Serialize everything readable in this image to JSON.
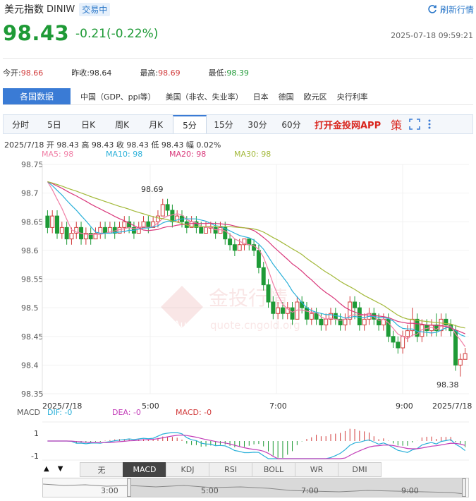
{
  "header": {
    "name": "美元指数",
    "code": "DINIW",
    "status": "交易中",
    "refresh_label": "刷新行情"
  },
  "quote": {
    "price": "98.43",
    "change": "-0.21(-0.22%)",
    "timestamp": "2025-07-18 09:59:21"
  },
  "stats": [
    {
      "label": "今开:",
      "value": "98.66",
      "color": "red"
    },
    {
      "label": "昨收:",
      "value": "98.64",
      "color": "none"
    },
    {
      "label": "最高:",
      "value": "98.69",
      "color": "red"
    },
    {
      "label": "最低:",
      "value": "98.39",
      "color": "grn"
    }
  ],
  "data_tabs": {
    "main": "各国数据",
    "items": [
      "中国（GDP、ppi等）",
      "美国（非农、失业率）",
      "日本",
      "德国",
      "欧元区",
      "央行利率"
    ]
  },
  "period_tabs": {
    "items": [
      "分时",
      "5日",
      "日K",
      "周K",
      "月K",
      "5分",
      "15分",
      "30分",
      "60分"
    ],
    "active": "5分",
    "app_link": "打开金投网APP",
    "strategy_icon": "策",
    "icons": [
      "fullscreen-icon",
      "more-icon"
    ]
  },
  "ohlc_line": "2025/7/18  开 98.43  高 98.43  收 98.43  低 98.43  幅 0.02%",
  "ma_legend": [
    {
      "label": "MA5: 98",
      "color": "#f07fa6"
    },
    {
      "label": "MA10: 98",
      "color": "#2ab0d9"
    },
    {
      "label": "MA20: 98",
      "color": "#d9377a"
    },
    {
      "label": "MA30: 98",
      "color": "#a3b93a"
    }
  ],
  "macd_legend": [
    {
      "label": "MACD",
      "color": "#555555"
    },
    {
      "label": "DIF: -0",
      "color": "#2ab0d9"
    },
    {
      "label": "DEA: -0",
      "color": "#c23cb8"
    },
    {
      "label": "MACD: -0",
      "color": "#d13b3b"
    }
  ],
  "indicator_tabs": {
    "items": [
      "无",
      "MACD",
      "KDJ",
      "RSI",
      "BOLL",
      "WR",
      "DMI"
    ],
    "active": "MACD"
  },
  "navigator_labels": [
    "3:00",
    "5:00",
    "7:00",
    "9:00"
  ],
  "watermark": {
    "text": "金投行情",
    "sub": "quote.cngold.org",
    "logo": "Au"
  },
  "colors": {
    "up": "#d13b3b",
    "down": "#1e9a36",
    "accent": "#3a7bd5",
    "app": "#d9251d"
  },
  "chart_data": {
    "type": "candlestick",
    "y_ticks": [
      "98.75",
      "98.7",
      "98.65",
      "98.6",
      "98.55",
      "98.5",
      "98.45",
      "98.4",
      "98.35"
    ],
    "ylim": [
      98.35,
      98.75
    ],
    "x_labels": [
      "2025/7/18",
      "5:00",
      "7:00",
      "9:00",
      "2025/7/18"
    ],
    "high_label": "98.69",
    "low_label": "98.38",
    "macd_ticks": [
      "1",
      "-1"
    ],
    "candles": [
      [
        98.66,
        98.64,
        98.67,
        98.63
      ],
      [
        98.64,
        98.66,
        98.67,
        98.63
      ],
      [
        98.66,
        98.63,
        98.67,
        98.62
      ],
      [
        98.63,
        98.64,
        98.65,
        98.62
      ],
      [
        98.64,
        98.62,
        98.65,
        98.61
      ],
      [
        98.62,
        98.63,
        98.64,
        98.61
      ],
      [
        98.63,
        98.64,
        98.65,
        98.62
      ],
      [
        98.64,
        98.62,
        98.65,
        98.61
      ],
      [
        98.62,
        98.63,
        98.64,
        98.61
      ],
      [
        98.63,
        98.62,
        98.64,
        98.61
      ],
      [
        98.62,
        98.63,
        98.64,
        98.62
      ],
      [
        98.63,
        98.64,
        98.65,
        98.62
      ],
      [
        98.64,
        98.63,
        98.65,
        98.62
      ],
      [
        98.63,
        98.64,
        98.65,
        98.63
      ],
      [
        98.64,
        98.63,
        98.65,
        98.62
      ],
      [
        98.63,
        98.64,
        98.65,
        98.63
      ],
      [
        98.64,
        98.65,
        98.66,
        98.63
      ],
      [
        98.65,
        98.64,
        98.66,
        98.63
      ],
      [
        98.64,
        98.63,
        98.65,
        98.62
      ],
      [
        98.63,
        98.64,
        98.65,
        98.63
      ],
      [
        98.64,
        98.65,
        98.66,
        98.64
      ],
      [
        98.65,
        98.64,
        98.66,
        98.63
      ],
      [
        98.64,
        98.65,
        98.66,
        98.64
      ],
      [
        98.65,
        98.66,
        98.67,
        98.64
      ],
      [
        98.66,
        98.68,
        98.69,
        98.66
      ],
      [
        98.68,
        98.67,
        98.69,
        98.66
      ],
      [
        98.67,
        98.65,
        98.68,
        98.64
      ],
      [
        98.65,
        98.66,
        98.67,
        98.65
      ],
      [
        98.66,
        98.65,
        98.67,
        98.64
      ],
      [
        98.65,
        98.64,
        98.66,
        98.63
      ],
      [
        98.64,
        98.65,
        98.66,
        98.64
      ],
      [
        98.65,
        98.64,
        98.66,
        98.63
      ],
      [
        98.64,
        98.63,
        98.65,
        98.63
      ],
      [
        98.63,
        98.64,
        98.65,
        98.63
      ],
      [
        98.64,
        98.64,
        98.65,
        98.63
      ],
      [
        98.64,
        98.63,
        98.65,
        98.62
      ],
      [
        98.63,
        98.64,
        98.65,
        98.63
      ],
      [
        98.64,
        98.62,
        98.65,
        98.61
      ],
      [
        98.62,
        98.61,
        98.63,
        98.6
      ],
      [
        98.61,
        98.6,
        98.62,
        98.59
      ],
      [
        98.6,
        98.61,
        98.62,
        98.6
      ],
      [
        98.61,
        98.62,
        98.62,
        98.6
      ],
      [
        98.62,
        98.61,
        98.62,
        98.6
      ],
      [
        98.61,
        98.6,
        98.62,
        98.59
      ],
      [
        98.6,
        98.57,
        98.61,
        98.56
      ],
      [
        98.57,
        98.54,
        98.58,
        98.53
      ],
      [
        98.54,
        98.51,
        98.55,
        98.5
      ],
      [
        98.51,
        98.49,
        98.52,
        98.48
      ],
      [
        98.49,
        98.5,
        98.51,
        98.48
      ],
      [
        98.5,
        98.49,
        98.51,
        98.48
      ],
      [
        98.49,
        98.5,
        98.51,
        98.48
      ],
      [
        98.5,
        98.48,
        98.51,
        98.47
      ],
      [
        98.48,
        98.51,
        98.52,
        98.48
      ],
      [
        98.51,
        98.5,
        98.52,
        98.49
      ],
      [
        98.5,
        98.48,
        98.51,
        98.47
      ],
      [
        98.48,
        98.49,
        98.5,
        98.47
      ],
      [
        98.49,
        98.48,
        98.5,
        98.47
      ],
      [
        98.48,
        98.47,
        98.49,
        98.46
      ],
      [
        98.47,
        98.48,
        98.49,
        98.46
      ],
      [
        98.48,
        98.49,
        98.5,
        98.47
      ],
      [
        98.49,
        98.48,
        98.5,
        98.47
      ],
      [
        98.48,
        98.47,
        98.49,
        98.46
      ],
      [
        98.47,
        98.48,
        98.49,
        98.46
      ],
      [
        98.48,
        98.51,
        98.52,
        98.47
      ],
      [
        98.51,
        98.5,
        98.52,
        98.48
      ],
      [
        98.5,
        98.47,
        98.51,
        98.46
      ],
      [
        98.47,
        98.48,
        98.49,
        98.46
      ],
      [
        98.48,
        98.49,
        98.5,
        98.47
      ],
      [
        98.49,
        98.48,
        98.5,
        98.47
      ],
      [
        98.48,
        98.47,
        98.49,
        98.46
      ],
      [
        98.47,
        98.48,
        98.49,
        98.46
      ],
      [
        98.48,
        98.45,
        98.49,
        98.44
      ],
      [
        98.45,
        98.44,
        98.46,
        98.43
      ],
      [
        98.44,
        98.43,
        98.45,
        98.42
      ],
      [
        98.43,
        98.45,
        98.46,
        98.42
      ],
      [
        98.45,
        98.46,
        98.47,
        98.44
      ],
      [
        98.46,
        98.48,
        98.5,
        98.45
      ],
      [
        98.48,
        98.45,
        98.49,
        98.44
      ],
      [
        98.45,
        98.47,
        98.48,
        98.44
      ],
      [
        98.47,
        98.46,
        98.48,
        98.45
      ],
      [
        98.46,
        98.47,
        98.48,
        98.45
      ],
      [
        98.47,
        98.46,
        98.49,
        98.45
      ],
      [
        98.46,
        98.48,
        98.49,
        98.45
      ],
      [
        98.48,
        98.47,
        98.49,
        98.46
      ],
      [
        98.47,
        98.46,
        98.48,
        98.45
      ],
      [
        98.46,
        98.4,
        98.47,
        98.39
      ],
      [
        98.4,
        98.41,
        98.42,
        98.38
      ],
      [
        98.41,
        98.42,
        98.43,
        98.41
      ]
    ]
  }
}
